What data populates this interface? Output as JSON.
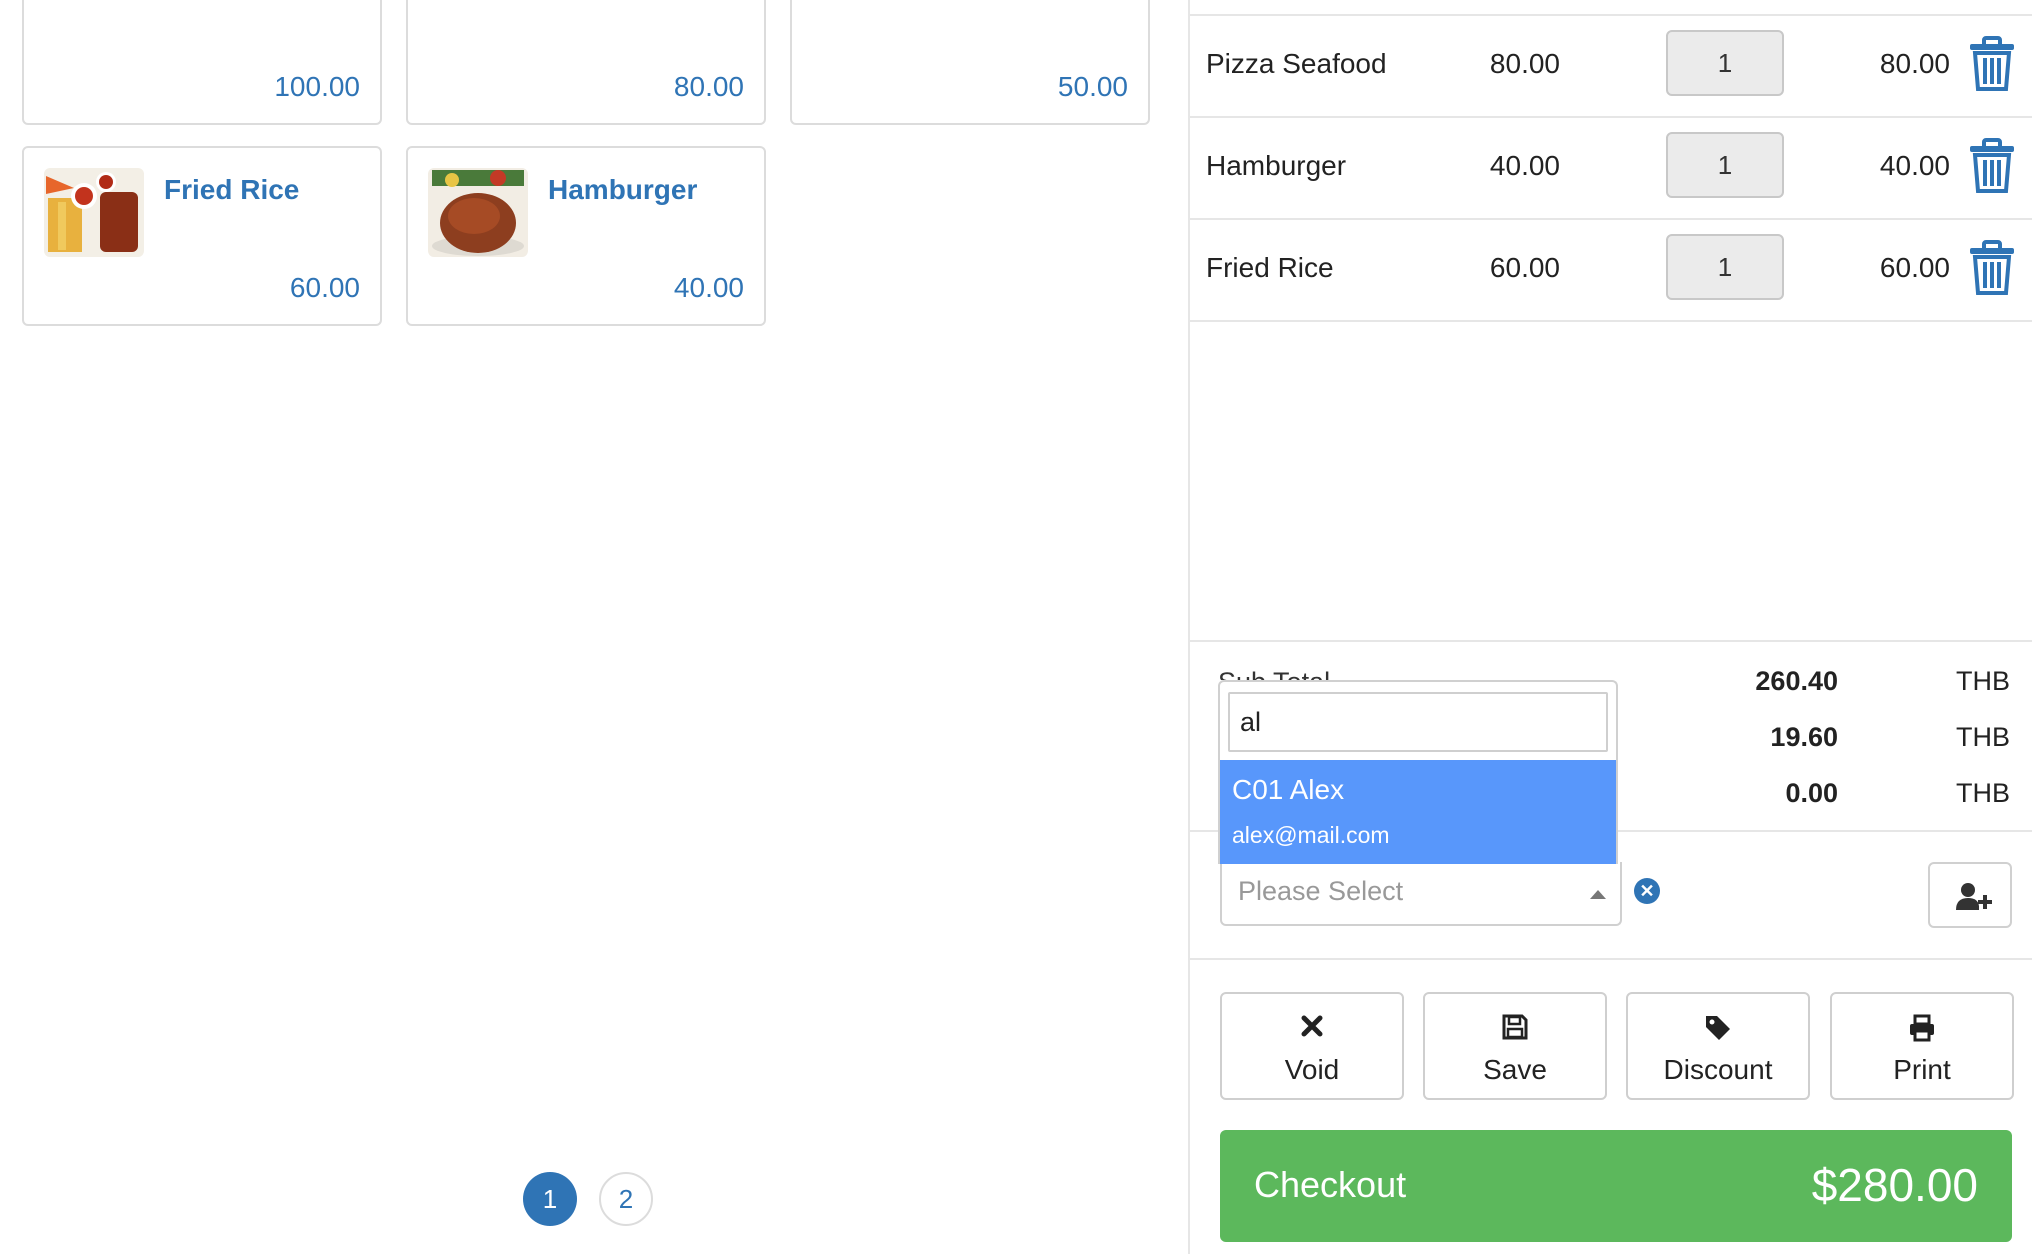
{
  "products": [
    {
      "name": "",
      "price": "100.00"
    },
    {
      "name": "",
      "price": "80.00"
    },
    {
      "name": "",
      "price": "50.00"
    },
    {
      "name": "Fried Rice",
      "price": "60.00"
    },
    {
      "name": "Hamburger",
      "price": "40.00"
    }
  ],
  "pagination": {
    "pages": [
      "1",
      "2"
    ],
    "current": "1"
  },
  "order_items": [
    {
      "name": "Pizza Seafood",
      "price": "80.00",
      "qty": "1",
      "total": "80.00"
    },
    {
      "name": "Hamburger",
      "price": "40.00",
      "qty": "1",
      "total": "40.00"
    },
    {
      "name": "Fried Rice",
      "price": "60.00",
      "qty": "1",
      "total": "60.00"
    }
  ],
  "summary": {
    "subtotal_label": "Sub Total",
    "rows": [
      {
        "amount": "260.40",
        "currency": "THB"
      },
      {
        "amount": "19.60",
        "currency": "THB"
      },
      {
        "amount": "0.00",
        "currency": "THB"
      }
    ]
  },
  "customer": {
    "placeholder": "Please Select",
    "search_value": "al",
    "option": {
      "title": "C01 Alex",
      "email": "alex@mail.com"
    }
  },
  "actions": {
    "void": "Void",
    "save": "Save",
    "discount": "Discount",
    "print": "Print"
  },
  "checkout": {
    "label": "Checkout",
    "amount": "$280.00"
  },
  "colors": {
    "accent": "#2f74b5",
    "checkout": "#5cb85c",
    "highlight": "#5897fb"
  },
  "icons": [
    "trash-icon",
    "close-icon",
    "save-icon",
    "tag-icon",
    "print-icon",
    "user-plus-icon"
  ]
}
